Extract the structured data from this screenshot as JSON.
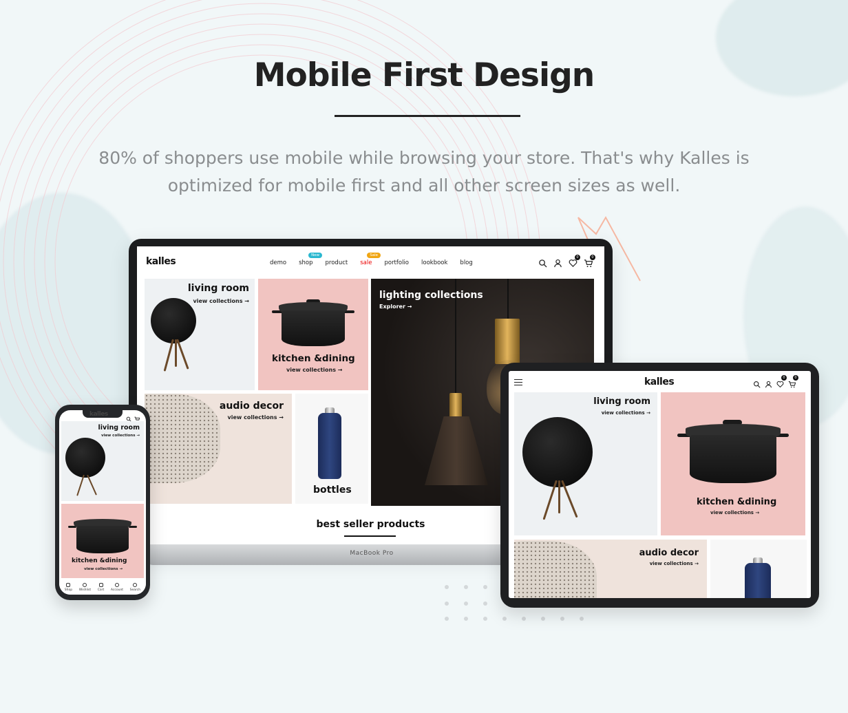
{
  "colors": {
    "background": "#f1f7f8",
    "pink_tile": "#f1c4c1",
    "light_tile": "#eef1f3",
    "beige_tile": "#efe3dc",
    "new_badge": "#2bb8d0",
    "sale_badge": "#f0a512",
    "sale_text": "#ec0101"
  },
  "hero": {
    "title": "Mobile First Design",
    "subtitle_line1": "80% of shoppers use mobile while browsing your store. That's why Kalles is",
    "subtitle_line2": "optimized for mobile first and all other screen sizes as well."
  },
  "laptop": {
    "base_label": "MacBook Pro",
    "site": {
      "logo": "kalles",
      "nav": [
        {
          "label": "demo",
          "badge": ""
        },
        {
          "label": "shop",
          "badge": "New"
        },
        {
          "label": "product",
          "badge": ""
        },
        {
          "label": "sale",
          "badge": "Sale"
        },
        {
          "label": "portfolio",
          "badge": ""
        },
        {
          "label": "lookbook",
          "badge": ""
        },
        {
          "label": "blog",
          "badge": ""
        }
      ],
      "icons": {
        "search": "search-icon",
        "account": "user-icon",
        "wishlist": "heart-icon",
        "cart": "cart-icon"
      },
      "wishlist_count": "0",
      "cart_count": "0",
      "tiles": {
        "living_room": {
          "title": "living room",
          "link": "view collections →"
        },
        "kitchen": {
          "title": "kitchen &dining",
          "link": "view collections →"
        },
        "lighting": {
          "title": "lighting collections",
          "link": "Explorer →"
        },
        "audio": {
          "title": "audio decor",
          "link": "view collections →"
        },
        "bottles": {
          "title": "bottles"
        }
      },
      "section_title": "best seller products"
    }
  },
  "tablet": {
    "logo": "kalles",
    "wishlist_count": "0",
    "cart_count": "0",
    "tiles": {
      "living_room": {
        "title": "living room",
        "link": "view collections →"
      },
      "kitchen": {
        "title": "kitchen &dining",
        "link": "view collections →"
      },
      "audio": {
        "title": "audio decor",
        "link": "view collections →"
      }
    }
  },
  "phone": {
    "logo": "kalles",
    "tiles": {
      "living_room": {
        "title": "living room",
        "link": "view collections →"
      },
      "kitchen": {
        "title": "kitchen &dining",
        "link": "view collections →"
      }
    },
    "tabbar": [
      "Shop",
      "Wishlist",
      "Cart",
      "Account",
      "Search"
    ]
  }
}
